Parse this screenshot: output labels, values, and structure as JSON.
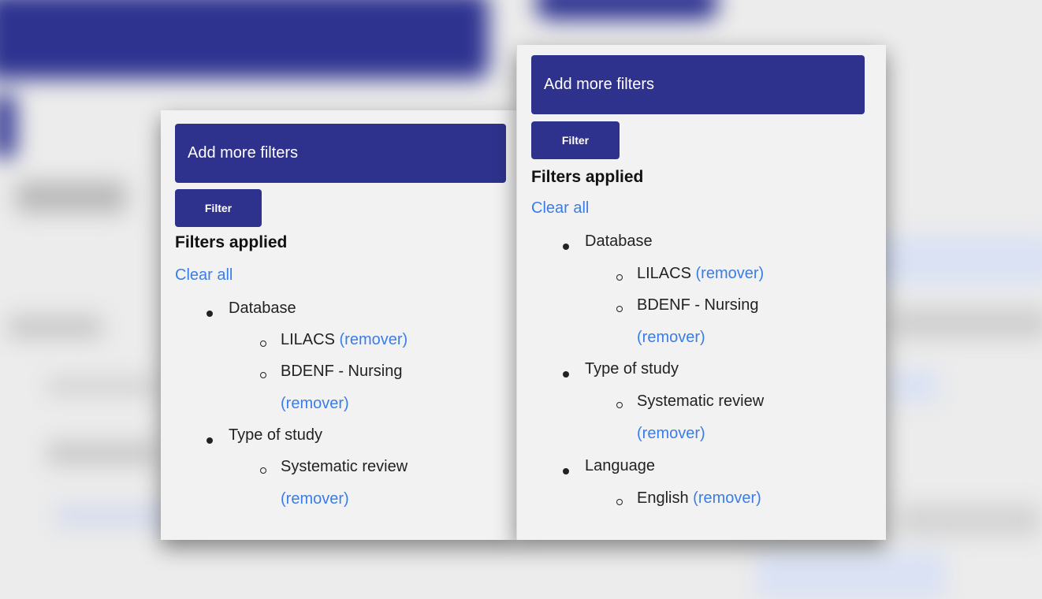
{
  "panels": [
    {
      "add_more_filters": "Add more filters",
      "filter_button": "Filter",
      "filters_applied": "Filters applied",
      "clear_all": "Clear all",
      "groups": [
        {
          "label": "Database",
          "items": [
            {
              "label": "LILACS",
              "remove": "(remover)"
            },
            {
              "label": "BDENF - Nursing",
              "remove": "(remover)"
            }
          ]
        },
        {
          "label": "Type of study",
          "items": [
            {
              "label": "Systematic review",
              "remove": "(remover)"
            }
          ]
        }
      ]
    },
    {
      "add_more_filters": "Add more filters",
      "filter_button": "Filter",
      "filters_applied": "Filters applied",
      "clear_all": "Clear all",
      "groups": [
        {
          "label": "Database",
          "items": [
            {
              "label": "LILACS",
              "remove": "(remover)"
            },
            {
              "label": "BDENF - Nursing",
              "remove": "(remover)"
            }
          ]
        },
        {
          "label": "Type of study",
          "items": [
            {
              "label": "Systematic review",
              "remove": "(remover)"
            }
          ]
        },
        {
          "label": "Language",
          "items": [
            {
              "label": "English",
              "remove": "(remover)"
            }
          ]
        }
      ]
    }
  ],
  "colors": {
    "primary": "#2e328c",
    "link": "#3b7de6",
    "panel_bg": "#f2f2f2"
  }
}
